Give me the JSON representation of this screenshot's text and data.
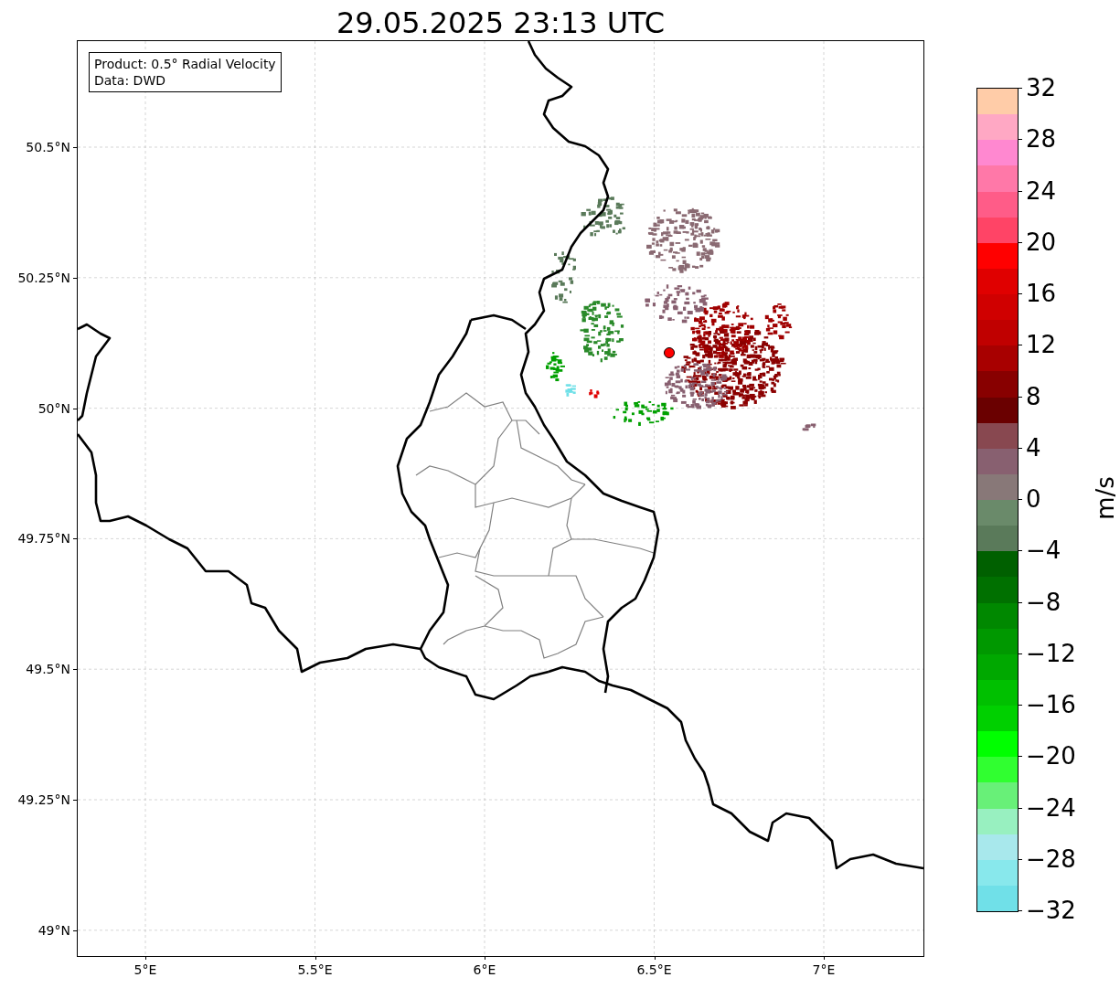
{
  "title": "29.05.2025 23:13 UTC",
  "map": {
    "legend": [
      "Product: 0.5° Radial Velocity",
      "Data: DWD"
    ],
    "yticks": [
      "50.5°N",
      "50.25°N",
      "50°N",
      "49.75°N",
      "49.5°N",
      "49.25°N",
      "49°N"
    ],
    "xticks": [
      "5°E",
      "5.5°E",
      "6°E",
      "6.5°E",
      "7°E"
    ]
  },
  "colorbar": {
    "label": "m/s",
    "ticks": [
      "32",
      "28",
      "24",
      "20",
      "16",
      "12",
      "8",
      "4",
      "0",
      "−4",
      "−8",
      "−12",
      "−16",
      "−20",
      "−24",
      "−28",
      "−32"
    ]
  }
}
